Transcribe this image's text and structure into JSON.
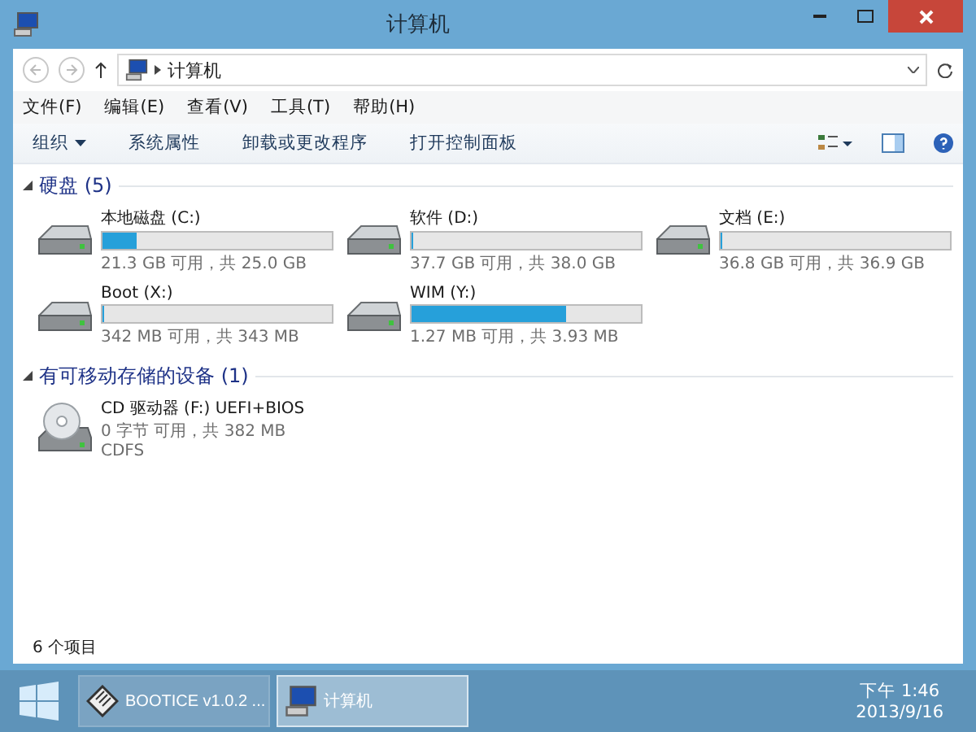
{
  "window": {
    "title": "计算机"
  },
  "address": {
    "path": "计算机"
  },
  "menu": [
    "文件(F)",
    "编辑(E)",
    "查看(V)",
    "工具(T)",
    "帮助(H)"
  ],
  "toolbar": [
    {
      "label": "组织",
      "dropdown": true
    },
    {
      "label": "系统属性",
      "dropdown": false
    },
    {
      "label": "卸载或更改程序",
      "dropdown": false
    },
    {
      "label": "打开控制面板",
      "dropdown": false
    }
  ],
  "groups": [
    {
      "title": "硬盘 (5)",
      "expanded": true,
      "items": [
        {
          "kind": "disk",
          "name": "本地磁盘 (C:)",
          "level": 0.148,
          "detail": "21.3 GB 可用，共 25.0 GB"
        },
        {
          "kind": "disk",
          "name": "软件 (D:)",
          "level": 0.008,
          "detail": "37.7 GB 可用，共 38.0 GB"
        },
        {
          "kind": "disk",
          "name": "文档 (E:)",
          "level": 0.003,
          "detail": "36.8 GB 可用，共 36.9 GB"
        },
        {
          "kind": "disk",
          "name": "Boot (X:)",
          "level": 0.003,
          "detail": "342 MB 可用，共 343 MB"
        },
        {
          "kind": "disk",
          "name": "WIM (Y:)",
          "level": 0.677,
          "detail": "1.27 MB 可用，共 3.93 MB"
        }
      ]
    },
    {
      "title": "有可移动存储的设备 (1)",
      "expanded": true,
      "items": [
        {
          "kind": "cd",
          "name": "CD 驱动器 (F:) UEFI+BIOS",
          "detail": "0 字节 可用，共 382 MB",
          "fs": "CDFS"
        }
      ]
    }
  ],
  "status_bar": "6 个项目",
  "taskbar": {
    "items": [
      {
        "kind": "tool",
        "label": "BOOTICE v1.0.2 ...",
        "selected": false
      },
      {
        "kind": "computer",
        "label": "计算机",
        "selected": true
      }
    ],
    "time": "下午 1:46",
    "date": "2013/9/16"
  }
}
